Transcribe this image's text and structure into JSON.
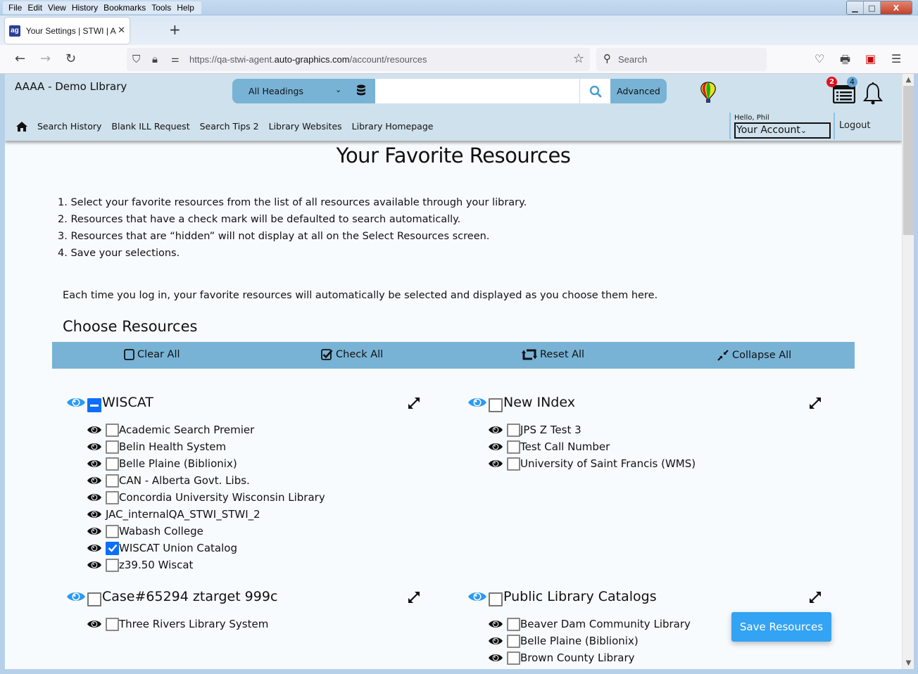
{
  "browser": {
    "menu": [
      "File",
      "Edit",
      "View",
      "History",
      "Bookmarks",
      "Tools",
      "Help"
    ],
    "tab_title": "Your Settings | STWI | AAAA | Auto-Graphics",
    "favicon_text": "ag",
    "new_tab": "+",
    "url_prefix": "https://qa-stwi-agent.",
    "url_domain": "auto-graphics.com",
    "url_path": "/account/resources",
    "search_placeholder": "Search",
    "window_controls": {
      "minimize": "▁",
      "maximize": "□",
      "close": "X"
    }
  },
  "header": {
    "library_name": "AAAA - Demo LIbrary",
    "search_scope": "All Headings",
    "search_value": "",
    "advanced_label": "Advanced",
    "badges": {
      "list_count": "2",
      "notification_count": "4"
    },
    "nav_links": [
      "Search History",
      "Blank ILL Request",
      "Search Tips 2",
      "Library Websites",
      "Library Homepage"
    ],
    "greeting": "Hello, Phil",
    "account_label": "Your Account",
    "logout_label": "Logout"
  },
  "page": {
    "title": "Your Favorite Resources",
    "instructions": [
      "1. Select your favorite resources from the list of all resources available through your library.",
      "2. Resources that have a check mark will be defaulted to search automatically.",
      "3. Resources that are “hidden” will not display at all on the Select Resources screen.",
      "4. Save your selections."
    ],
    "note": "Each time you log in, your favorite resources will automatically be selected and displayed as you choose them here.",
    "choose_title": "Choose Resources",
    "actions": {
      "clear_all": "Clear All",
      "check_all": "Check All",
      "reset_all": "Reset All",
      "collapse_all": "Collapse All"
    },
    "save_label": "Save Resources"
  },
  "groups": [
    {
      "name": "WISCAT",
      "state": "partial",
      "items": [
        {
          "name": "Academic Search Premier",
          "checked": false,
          "has_checkbox": true
        },
        {
          "name": "Belin Health System",
          "checked": false,
          "has_checkbox": true
        },
        {
          "name": "Belle Plaine (Biblionix)",
          "checked": false,
          "has_checkbox": true
        },
        {
          "name": "CAN - Alberta Govt. Libs.",
          "checked": false,
          "has_checkbox": true
        },
        {
          "name": "Concordia University Wisconsin Library",
          "checked": false,
          "has_checkbox": true
        },
        {
          "name": "JAC_internalQA_STWI_STWI_2",
          "checked": false,
          "has_checkbox": false
        },
        {
          "name": "Wabash College",
          "checked": false,
          "has_checkbox": true
        },
        {
          "name": "WISCAT Union Catalog",
          "checked": true,
          "has_checkbox": true
        },
        {
          "name": "z39.50 Wiscat",
          "checked": false,
          "has_checkbox": true
        }
      ]
    },
    {
      "name": "New INdex",
      "state": "unchecked",
      "items": [
        {
          "name": "JPS Z Test 3",
          "checked": false,
          "has_checkbox": true
        },
        {
          "name": "Test Call Number",
          "checked": false,
          "has_checkbox": true
        },
        {
          "name": "University of Saint Francis (WMS)",
          "checked": false,
          "has_checkbox": true
        }
      ]
    },
    {
      "name": "Case#65294 ztarget 999c",
      "state": "unchecked",
      "items": [
        {
          "name": "Three Rivers Library System",
          "checked": false,
          "has_checkbox": true
        }
      ]
    },
    {
      "name": "Public Library Catalogs",
      "state": "unchecked",
      "items": [
        {
          "name": "Beaver Dam Community Library",
          "checked": false,
          "has_checkbox": true
        },
        {
          "name": "Belle Plaine (Biblionix)",
          "checked": false,
          "has_checkbox": true
        },
        {
          "name": "Brown County Library",
          "checked": false,
          "has_checkbox": true
        }
      ]
    }
  ],
  "colors": {
    "header_bg": "#cfe1ec",
    "accent": "#78b3d6",
    "checkbox_blue": "#0d6efd",
    "eye_blue": "#2b9af3",
    "save_button": "#33a3f4"
  }
}
